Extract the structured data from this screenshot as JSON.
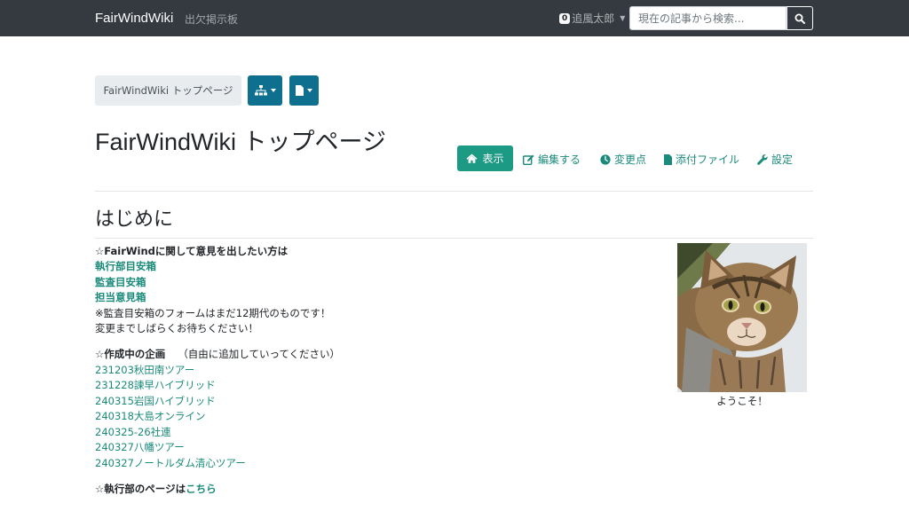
{
  "navbar": {
    "brand": "FairWindWiki",
    "link": "出欠掲示板",
    "user_badge": "0",
    "user_name": "追風太郎",
    "search_placeholder": "現在の記事から検索..."
  },
  "breadcrumb": {
    "label": "FairWindWiki トップページ"
  },
  "page": {
    "title": "FairWindWiki トップページ"
  },
  "actions": {
    "view": "表示",
    "edit": "編集する",
    "changes": "変更点",
    "attachments": "添付ファイル",
    "settings": "設定"
  },
  "content": {
    "section_title": "はじめに",
    "opinion_heading": "☆FairWindに関して意見を出したい方は",
    "opinion_links": [
      "執行部目安箱",
      "監査目安箱",
      "担当意見箱"
    ],
    "note1": "※監査目安箱のフォームはまだ12期代のものです！",
    "note2": "変更までしばらくお待ちください！",
    "projects_heading": "☆作成中の企画",
    "projects_note": "（自由に追加していってください）",
    "projects": [
      "231203秋田南ツアー",
      "231228諫早ハイブリッド",
      "240315岩国ハイブリッド",
      "240318大島オンライン",
      "240325-26社連",
      "240327八幡ツアー",
      "240327ノートルダム清心ツアー"
    ],
    "exec_prefix": "☆執行部のページは",
    "exec_link": "こちら",
    "image_caption": "ようこそ！"
  }
}
